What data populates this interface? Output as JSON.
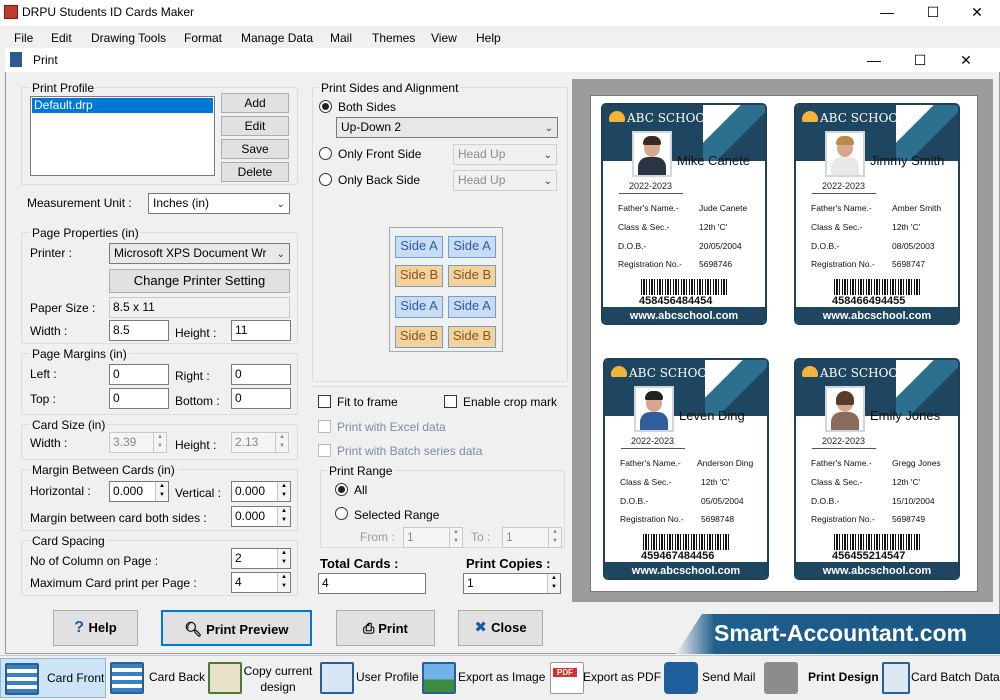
{
  "app": {
    "title": "DRPU Students ID Cards Maker",
    "window_buttons": [
      "—",
      "☐",
      "✕"
    ]
  },
  "menu": [
    "File",
    "Edit",
    "Drawing Tools",
    "Format",
    "Manage Data",
    "Mail",
    "Themes",
    "View",
    "Help"
  ],
  "dialog": {
    "title": "Print",
    "window_buttons": [
      "—",
      "☐",
      "✕"
    ]
  },
  "print_profile": {
    "legend": "Print Profile",
    "selected": "Default.drp",
    "buttons": {
      "add": "Add",
      "edit": "Edit",
      "save": "Save",
      "delete": "Delete"
    }
  },
  "measurement": {
    "label": "Measurement Unit :",
    "value": "Inches (in)"
  },
  "page_properties": {
    "legend": "Page Properties (in)",
    "printer_label": "Printer :",
    "printer_value": "Microsoft XPS Document Wr",
    "change_printer": "Change Printer Setting",
    "paper_size_label": "Paper Size :",
    "paper_size_value": "8.5 x 11",
    "width_label": "Width :",
    "width_value": "8.5",
    "height_label": "Height :",
    "height_value": "11"
  },
  "page_margins": {
    "legend": "Page Margins (in)",
    "left_label": "Left :",
    "left_value": "0",
    "right_label": "Right :",
    "right_value": "0",
    "top_label": "Top :",
    "top_value": "0",
    "bottom_label": "Bottom :",
    "bottom_value": "0"
  },
  "card_size": {
    "legend": "Card Size (in)",
    "width_label": "Width :",
    "width_value": "3.39",
    "height_label": "Height :",
    "height_value": "2.13"
  },
  "margin_between": {
    "legend": "Margin Between Cards (in)",
    "horizontal_label": "Horizontal :",
    "horizontal_value": "0.000",
    "vertical_label": "Vertical :",
    "vertical_value": "0.000",
    "both_sides_label": "Margin between card both sides :",
    "both_sides_value": "0.000"
  },
  "card_spacing": {
    "legend": "Card Spacing",
    "columns_label": "No of Column on Page :",
    "columns_value": "2",
    "max_label": "Maximum Card print per Page :",
    "max_value": "4"
  },
  "print_sides": {
    "legend": "Print Sides and Alignment",
    "both_label": "Both Sides",
    "both_value": "Up-Down 2",
    "front_label": "Only Front Side",
    "front_value": "Head Up",
    "back_label": "Only Back Side",
    "back_value": "Head Up",
    "side_a": "Side A",
    "side_b": "Side B"
  },
  "options": {
    "fit_to_frame": "Fit to frame",
    "crop_mark": "Enable crop mark",
    "excel": "Print with Excel data",
    "batch": "Print with Batch series data"
  },
  "print_range": {
    "legend": "Print Range",
    "all": "All",
    "selected": "Selected Range",
    "from_label": "From :",
    "from_value": "1",
    "to_label": "To :",
    "to_value": "1"
  },
  "totals": {
    "total_label": "Total Cards :",
    "total_value": "4",
    "copies_label": "Print Copies :",
    "copies_value": "1"
  },
  "cards": [
    {
      "school": "ABC SCHOOL",
      "name": "Mike Canete",
      "year": "2022-2023",
      "father_label": "Father's Name.-",
      "father": "Jude Canete",
      "class_label": "Class & Sec.-",
      "class": "12th 'C'",
      "dob_label": "D.O.B.-",
      "dob": "20/05/2004",
      "reg_label": "Registration No.-",
      "reg": "5698746",
      "barcode": "458456484454",
      "website": "www.abcschool.com"
    },
    {
      "school": "ABC SCHOOL",
      "name": "Jimmy Smith",
      "year": "2022-2023",
      "father_label": "Father's Name.-",
      "father": "Amber Smith",
      "class_label": "Class & Sec.-",
      "class": "12th 'C'",
      "dob_label": "D.O.B.-",
      "dob": "08/05/2003",
      "reg_label": "Registration No.-",
      "reg": "5698747",
      "barcode": "458466494455",
      "website": "www.abcschool.com"
    },
    {
      "school": "ABC SCHOOL",
      "name": "Leven Ding",
      "year": "2022-2023",
      "father_label": "Father's Name.-",
      "father": "Anderson Ding",
      "class_label": "Class & Sec.-",
      "class": "12th 'C'",
      "dob_label": "D.O.B.-",
      "dob": "05/05/2004",
      "reg_label": "Registration No.-",
      "reg": "5698748",
      "barcode": "459467484456",
      "website": "www.abcschool.com"
    },
    {
      "school": "ABC SCHOOL",
      "name": "Emily Jones",
      "year": "2022-2023",
      "father_label": "Father's Name.-",
      "father": "Gregg Jones",
      "class_label": "Class & Sec.-",
      "class": "12th 'C'",
      "dob_label": "D.O.B.-",
      "dob": "15/10/2004",
      "reg_label": "Registration No.-",
      "reg": "5698749",
      "barcode": "456455214547",
      "website": "www.abcschool.com"
    }
  ],
  "bottom_buttons": {
    "help": "Help",
    "preview": "Print Preview",
    "print": "Print",
    "close": "Close"
  },
  "banner": "Smart-Accountant.com",
  "toolbar": {
    "card_front": "Card Front",
    "card_back": "Card Back",
    "copy_design_1": "Copy current",
    "copy_design_2": "design",
    "user_profile": "User Profile",
    "export_image": "Export as Image",
    "export_pdf": "Export as PDF",
    "pdf_badge": "PDF",
    "send_mail": "Send Mail",
    "print_design": "Print Design",
    "batch_data": "Card Batch Data"
  },
  "colors": {
    "card_navy": "#1e4661",
    "accent_blue": "#2a5f95",
    "banner": "#1a5682"
  }
}
